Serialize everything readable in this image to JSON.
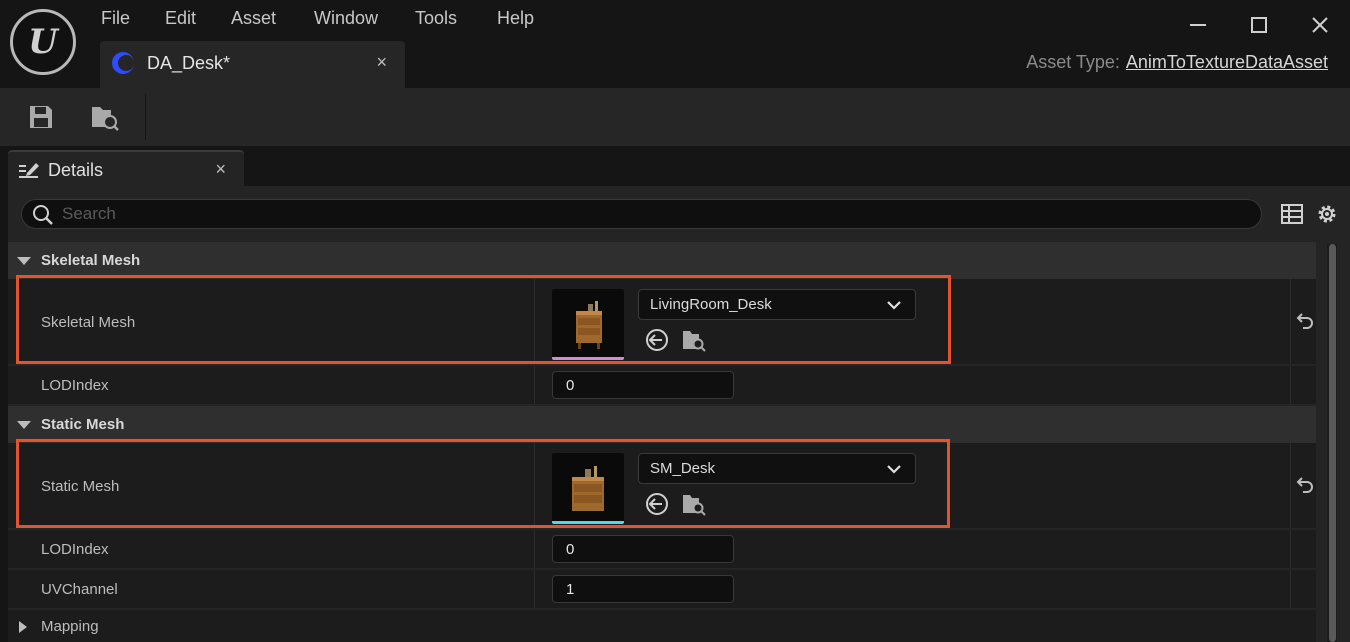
{
  "menu": [
    "File",
    "Edit",
    "Asset",
    "Window",
    "Tools",
    "Help"
  ],
  "document_tab": {
    "title": "DA_Desk*",
    "close": "×"
  },
  "asset_type": {
    "label": "Asset Type:",
    "value": "AnimToTextureDataAsset"
  },
  "window_controls": {
    "minimize": "—",
    "maximize": "☐",
    "close": "✕"
  },
  "toolbar": {
    "save_icon": "save-icon",
    "browse_icon": "browse-folder-icon"
  },
  "details_tab": {
    "title": "Details",
    "close": "×"
  },
  "search": {
    "placeholder": "Search",
    "value": ""
  },
  "sections": {
    "skeletal": {
      "title": "Skeletal Mesh",
      "mesh_label": "Skeletal Mesh",
      "mesh_value": "LivingRoom_Desk",
      "thumb_accent": "#d38cd6",
      "lod_label": "LODIndex",
      "lod_value": "0"
    },
    "static": {
      "title": "Static Mesh",
      "mesh_label": "Static Mesh",
      "mesh_value": "SM_Desk",
      "thumb_accent": "#58d4e2",
      "lod_label": "LODIndex",
      "lod_value": "0",
      "uv_label": "UVChannel",
      "uv_value": "1"
    },
    "mapping": {
      "title": "Mapping"
    }
  },
  "colors": {
    "highlight": "#e2542f",
    "accent_blue": "#2d4cff"
  }
}
